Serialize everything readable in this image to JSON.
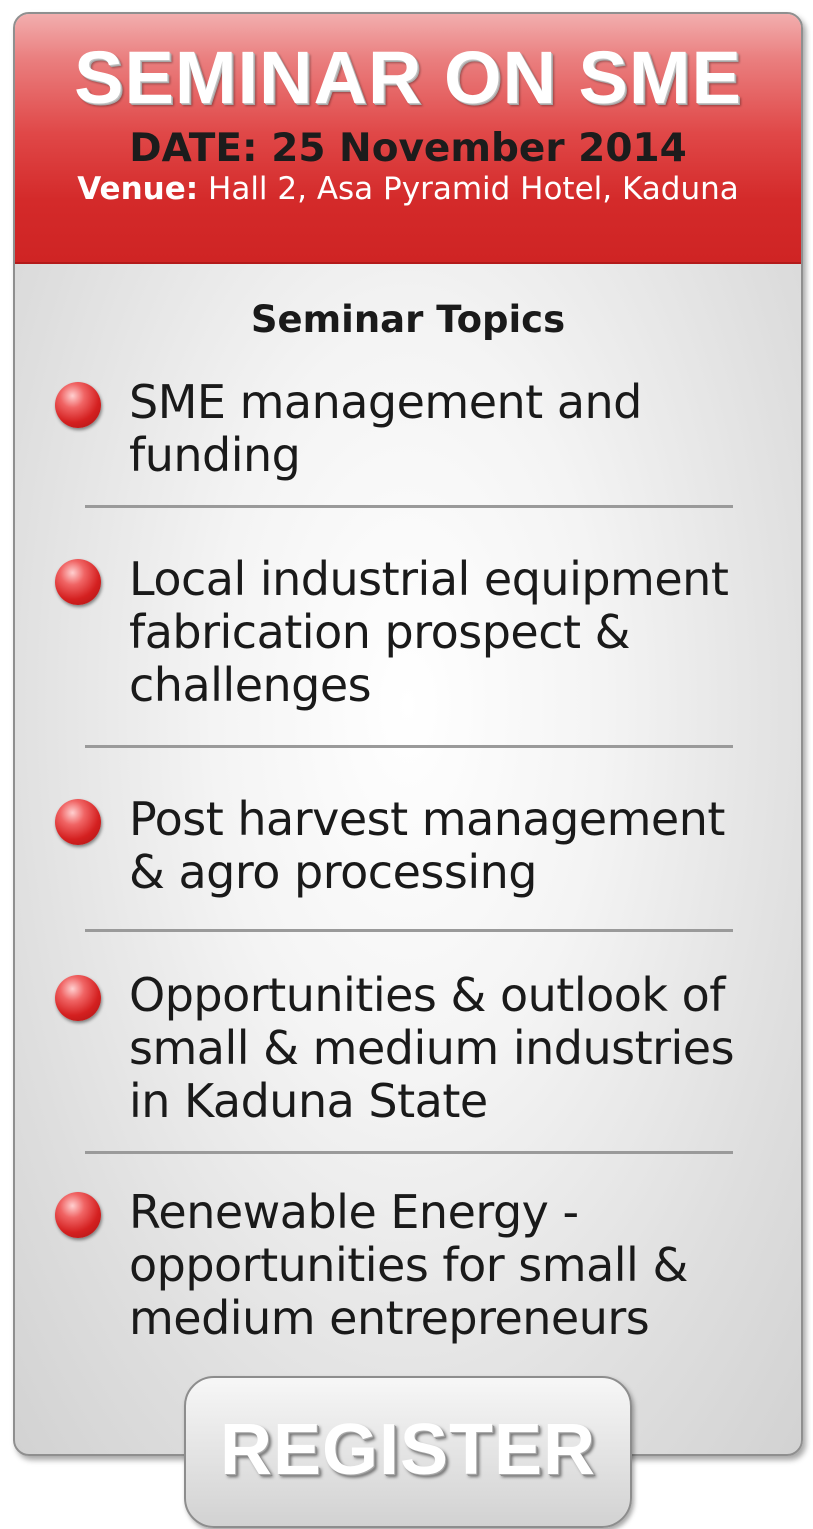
{
  "header": {
    "title": "SEMINAR ON SME",
    "date": "DATE: 25 November 2014",
    "venue_label": "Venue:",
    "venue_value": " Hall 2, Asa Pyramid Hotel, Kaduna"
  },
  "topics_heading": "Seminar Topics",
  "topics": [
    {
      "label": "SME management and funding"
    },
    {
      "label": "Local industrial equipment fabrication prospect & challenges"
    },
    {
      "label": "Post harvest management & agro processing"
    },
    {
      "label": "Opportunities & outlook of small & medium industries in Kaduna State"
    },
    {
      "label": "Renewable Energy - opportunities for small & medium entrepreneurs"
    }
  ],
  "register_label": "REGISTER",
  "colors": {
    "header_red": "#d42a2a",
    "bullet_red": "#d42020",
    "divider_gray": "#9a9a9a"
  },
  "icons": {
    "bullet": "bullet-dot-icon"
  }
}
